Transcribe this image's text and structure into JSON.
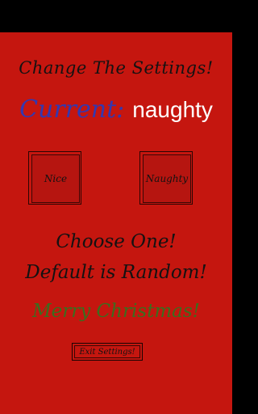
{
  "settings": {
    "title": "Change The Settings!",
    "current_label": "Current:",
    "current_value": "naughty",
    "nice_label": "Nice",
    "naughty_label": "Naughty",
    "choose_text": "Choose One!",
    "default_text": "Default is Random!",
    "merry_text": "Merry Christmas!",
    "exit_label": "Exit Settings!"
  },
  "colors": {
    "background": "#c5160f",
    "current_label": "#3338b0",
    "current_value": "#ffffff",
    "merry_text": "#3b6e1e"
  }
}
